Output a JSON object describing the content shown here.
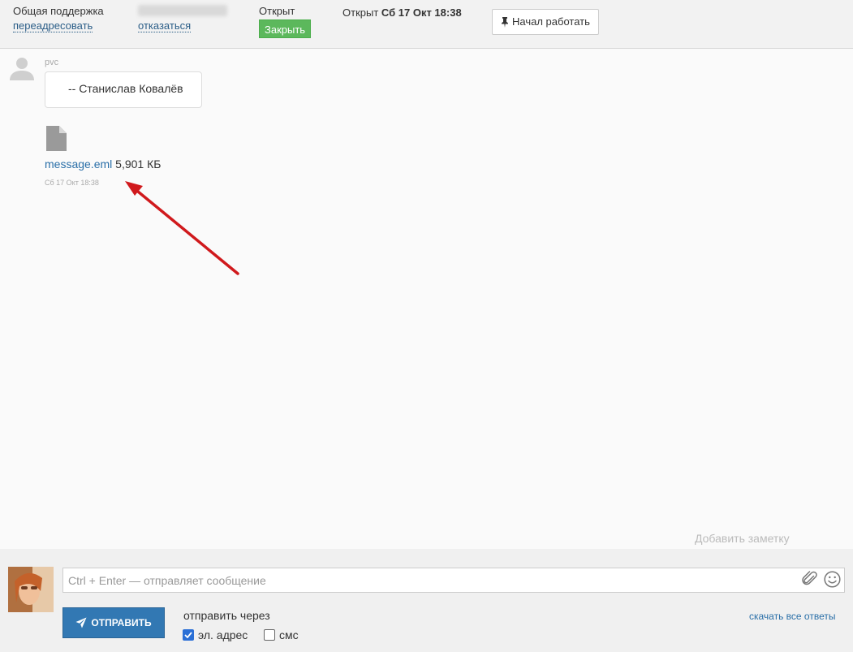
{
  "topbar": {
    "queue_name": "Общая поддержка",
    "forward_link": "переадресовать",
    "refuse_link": "отказаться",
    "status_label": "Открыт",
    "close_button": "Закрыть",
    "opened_prefix": "Открыт",
    "opened_date": "Сб 17 Окт 18:38",
    "start_work_button": "Начал работать"
  },
  "message": {
    "sender": "pvc",
    "body": "-- Станислав Ковалёв",
    "attachment_name": "message.eml",
    "attachment_size": "5,901 КБ",
    "timestamp": "Сб 17 Окт 18:38"
  },
  "add_note_link": "Добавить заметку",
  "composer": {
    "placeholder": "Ctrl + Enter — отправляет сообщение",
    "send_button": "ОТПРАВИТЬ",
    "send_via_label": "отправить через",
    "options": [
      {
        "label": "эл. адрес",
        "checked": true
      },
      {
        "label": "смс",
        "checked": false
      }
    ],
    "download_all_link": "скачать все ответы"
  },
  "colors": {
    "close_button": "#5cb85c",
    "send_button": "#3278b3",
    "link": "#2a6fa8",
    "annotation_arrow": "#d0191c"
  }
}
